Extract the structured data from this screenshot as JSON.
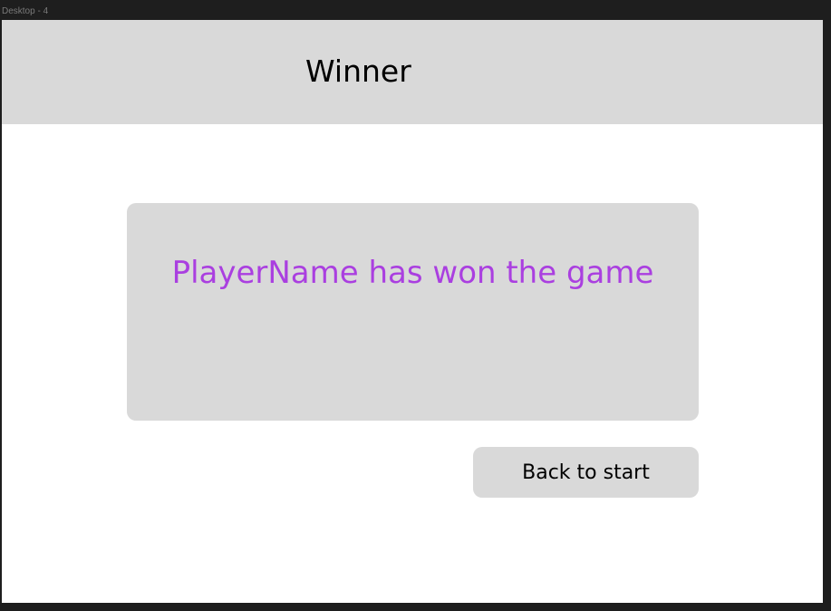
{
  "frame": {
    "label": "Desktop - 4"
  },
  "header": {
    "title": "Winner"
  },
  "message": {
    "text": "PlayerName has won the game"
  },
  "actions": {
    "back_label": "Back to start"
  },
  "colors": {
    "header_background": "#d9d9d9",
    "card_background": "#d9d9d9",
    "message_text": "#aa3fe0",
    "page_background": "#ffffff",
    "canvas_background": "#1e1e1e"
  }
}
